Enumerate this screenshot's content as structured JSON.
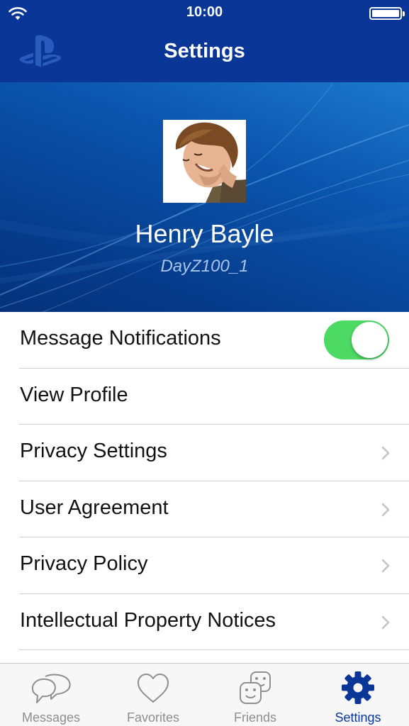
{
  "status_bar": {
    "time": "10:00"
  },
  "nav": {
    "title": "Settings"
  },
  "profile": {
    "name": "Henry Bayle",
    "online_id": "DayZ100_1"
  },
  "settings": [
    {
      "label": "Message Notifications",
      "control": "toggle",
      "on": true
    },
    {
      "label": "View Profile",
      "control": "none"
    },
    {
      "label": "Privacy Settings",
      "control": "chevron"
    },
    {
      "label": "User Agreement",
      "control": "chevron"
    },
    {
      "label": "Privacy Policy",
      "control": "chevron"
    },
    {
      "label": "Intellectual Property Notices",
      "control": "chevron"
    }
  ],
  "tabs": [
    {
      "label": "Messages",
      "icon": "messages-icon",
      "active": false
    },
    {
      "label": "Favorites",
      "icon": "heart-icon",
      "active": false
    },
    {
      "label": "Friends",
      "icon": "friends-icon",
      "active": false
    },
    {
      "label": "Settings",
      "icon": "gear-icon",
      "active": true
    }
  ],
  "colors": {
    "header": "#0a3797",
    "toggle_on": "#4cd964",
    "tab_active": "#0a3797",
    "tab_inactive": "#8e8e93"
  }
}
